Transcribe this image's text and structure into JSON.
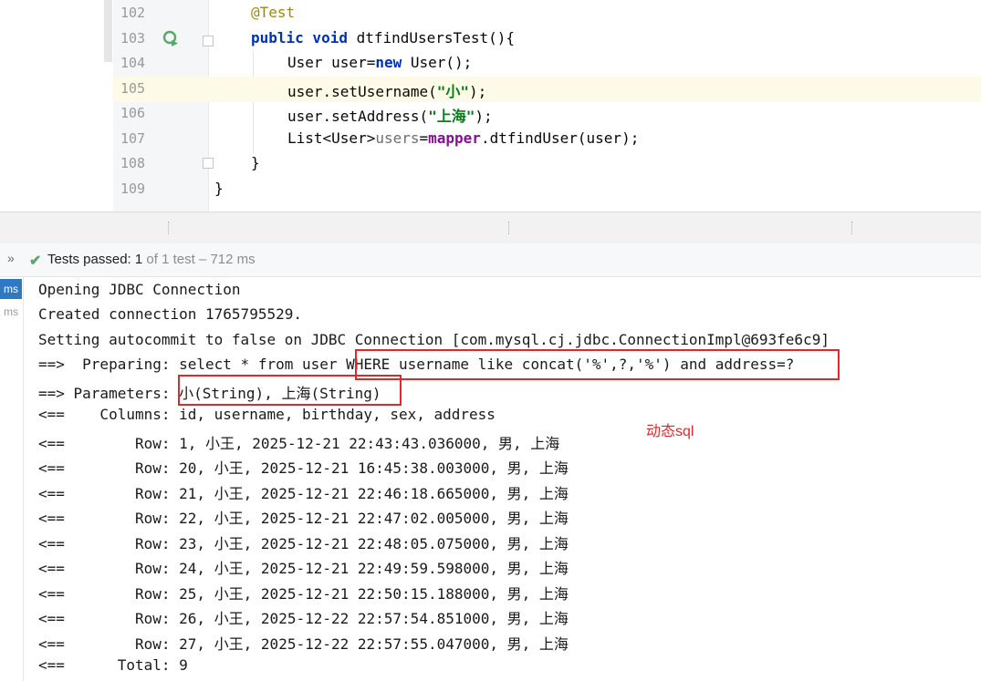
{
  "editor": {
    "lines": [
      {
        "num": "102",
        "text": "@Test"
      },
      {
        "num": "103",
        "kw": "public void ",
        "rest": "dtfindUsersTest(){"
      },
      {
        "num": "104",
        "pre": "User user=",
        "kw": "new",
        "rest": " User();"
      },
      {
        "num": "105",
        "pre": "user.setUsername(",
        "str": "\"小\"",
        "rest": ");"
      },
      {
        "num": "106",
        "pre": "user.setAddress(",
        "str": "\"上海\"",
        "rest": ");"
      },
      {
        "num": "107",
        "pre": "List<User>",
        "unused": "users",
        "mid": "=",
        "fld": "mapper",
        "rest": ".dtfindUser(user);"
      },
      {
        "num": "108",
        "text": "}"
      },
      {
        "num": "109",
        "text": "}"
      }
    ]
  },
  "status": {
    "label": "Tests passed:",
    "passed": "1",
    "detail": "of 1 test – 712 ms"
  },
  "sidebar": {
    "tab_active": "ms",
    "tab_inactive": "ms"
  },
  "console": {
    "lines": [
      "Opening JDBC Connection",
      "Created connection 1765795529.",
      "Setting autocommit to false on JDBC Connection [com.mysql.cj.jdbc.ConnectionImpl@693fe6c9]",
      "==>  Preparing: select * from user WHERE username like concat('%',?,'%') and address=?",
      "==> Parameters: 小(String), 上海(String)",
      "<==    Columns: id, username, birthday, sex, address",
      "<==        Row: 1, 小王, 2025-12-21 22:43:43.036000, 男, 上海",
      "<==        Row: 20, 小王, 2025-12-21 16:45:38.003000, 男, 上海",
      "<==        Row: 21, 小王, 2025-12-21 22:46:18.665000, 男, 上海",
      "<==        Row: 22, 小王, 2025-12-21 22:47:02.005000, 男, 上海",
      "<==        Row: 23, 小王, 2025-12-21 22:48:05.075000, 男, 上海",
      "<==        Row: 24, 小王, 2025-12-21 22:49:59.598000, 男, 上海",
      "<==        Row: 25, 小王, 2025-12-21 22:50:15.188000, 男, 上海",
      "<==        Row: 26, 小王, 2025-12-22 22:57:54.851000, 男, 上海",
      "<==        Row: 27, 小王, 2025-12-22 22:57:55.047000, 男, 上海",
      "<==      Total: 9"
    ]
  },
  "annotation": {
    "label": "动态sql"
  }
}
